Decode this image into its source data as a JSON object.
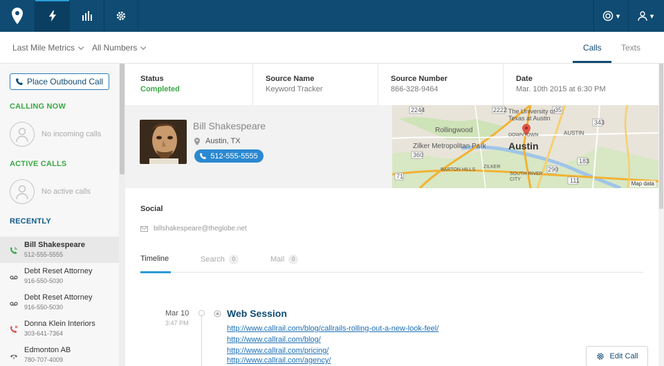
{
  "nav": {
    "items": [
      "location-pin-logo",
      "activity-bolt",
      "reports-bar-chart",
      "settings-gear"
    ],
    "right_icons": [
      "support-lifebuoy-icon",
      "user-account-icon"
    ],
    "active_color": "#2b9bd6",
    "bar_color": "#0f4b72"
  },
  "subnav": {
    "filter1": "Last Mile Metrics",
    "filter2": "All Numbers",
    "tabs": [
      "Calls",
      "Texts"
    ]
  },
  "sidebar": {
    "place_call_label": "Place Outbound Call",
    "calling_now_heading": "CALLING NOW",
    "no_incoming": "No incoming calls",
    "active_calls_heading": "ACTIVE CALLS",
    "no_active": "No active calls",
    "recently_heading": "RECENTLY",
    "recent": [
      {
        "name": "Bill Shakespeare",
        "phone": "512-555-5555",
        "icon": "phone-answered-icon"
      },
      {
        "name": "Debt Reset Attorney",
        "phone": "916-550-5030",
        "icon": "voicemail-icon"
      },
      {
        "name": "Debt Reset Attorney",
        "phone": "916-550-5030",
        "icon": "voicemail-icon"
      },
      {
        "name": "Donna Klein Interiors",
        "phone": "303-641-7364",
        "icon": "phone-missed-icon"
      },
      {
        "name": "Edmonton AB",
        "phone": "780-707-4009",
        "icon": "phone-hangup-icon"
      }
    ]
  },
  "call": {
    "status_label": "Status",
    "status_value": "Completed",
    "source_name_label": "Source Name",
    "source_name_value": "Keyword Tracker",
    "source_number_label": "Source Number",
    "source_number_value": "866-328-9464",
    "date_label": "Date",
    "date_value": "Mar. 10th 2015 at 6:30 PM"
  },
  "caller": {
    "name": "Bill Shakespeare",
    "location": "Austin, TX",
    "phone": "512-555-5555"
  },
  "map": {
    "city": "Austin",
    "labels": [
      "The University of Texas at Austin",
      "Rollingwood",
      "Zilker Metropolitan Park",
      "DOWNTOWN",
      "AUSTIN",
      "BARTON HILLS",
      "ZILKER",
      "SOUTH RIVER CITY",
      "Map data"
    ],
    "route_shields": [
      "2244",
      "360",
      "71",
      "290",
      "183",
      "35",
      "343",
      "2222",
      "111"
    ]
  },
  "social": {
    "label": "Social",
    "email": "billshakespeare@theglobe.net"
  },
  "tabs": [
    {
      "label": "Timeline",
      "count": ""
    },
    {
      "label": "Search",
      "count": "0"
    },
    {
      "label": "Mail",
      "count": "0"
    }
  ],
  "timeline": {
    "date": "Mar 10",
    "time": "3:47 PM",
    "event_title": "Web Session",
    "links": [
      "http://www.callrail.com/blog/callrails-rolling-out-a-new-look-feel/",
      "http://www.callrail.com/blog/",
      "http://www.callrail.com/pricing/",
      "http://www.callrail.com/agency/"
    ]
  },
  "edit_label": "Edit Call"
}
